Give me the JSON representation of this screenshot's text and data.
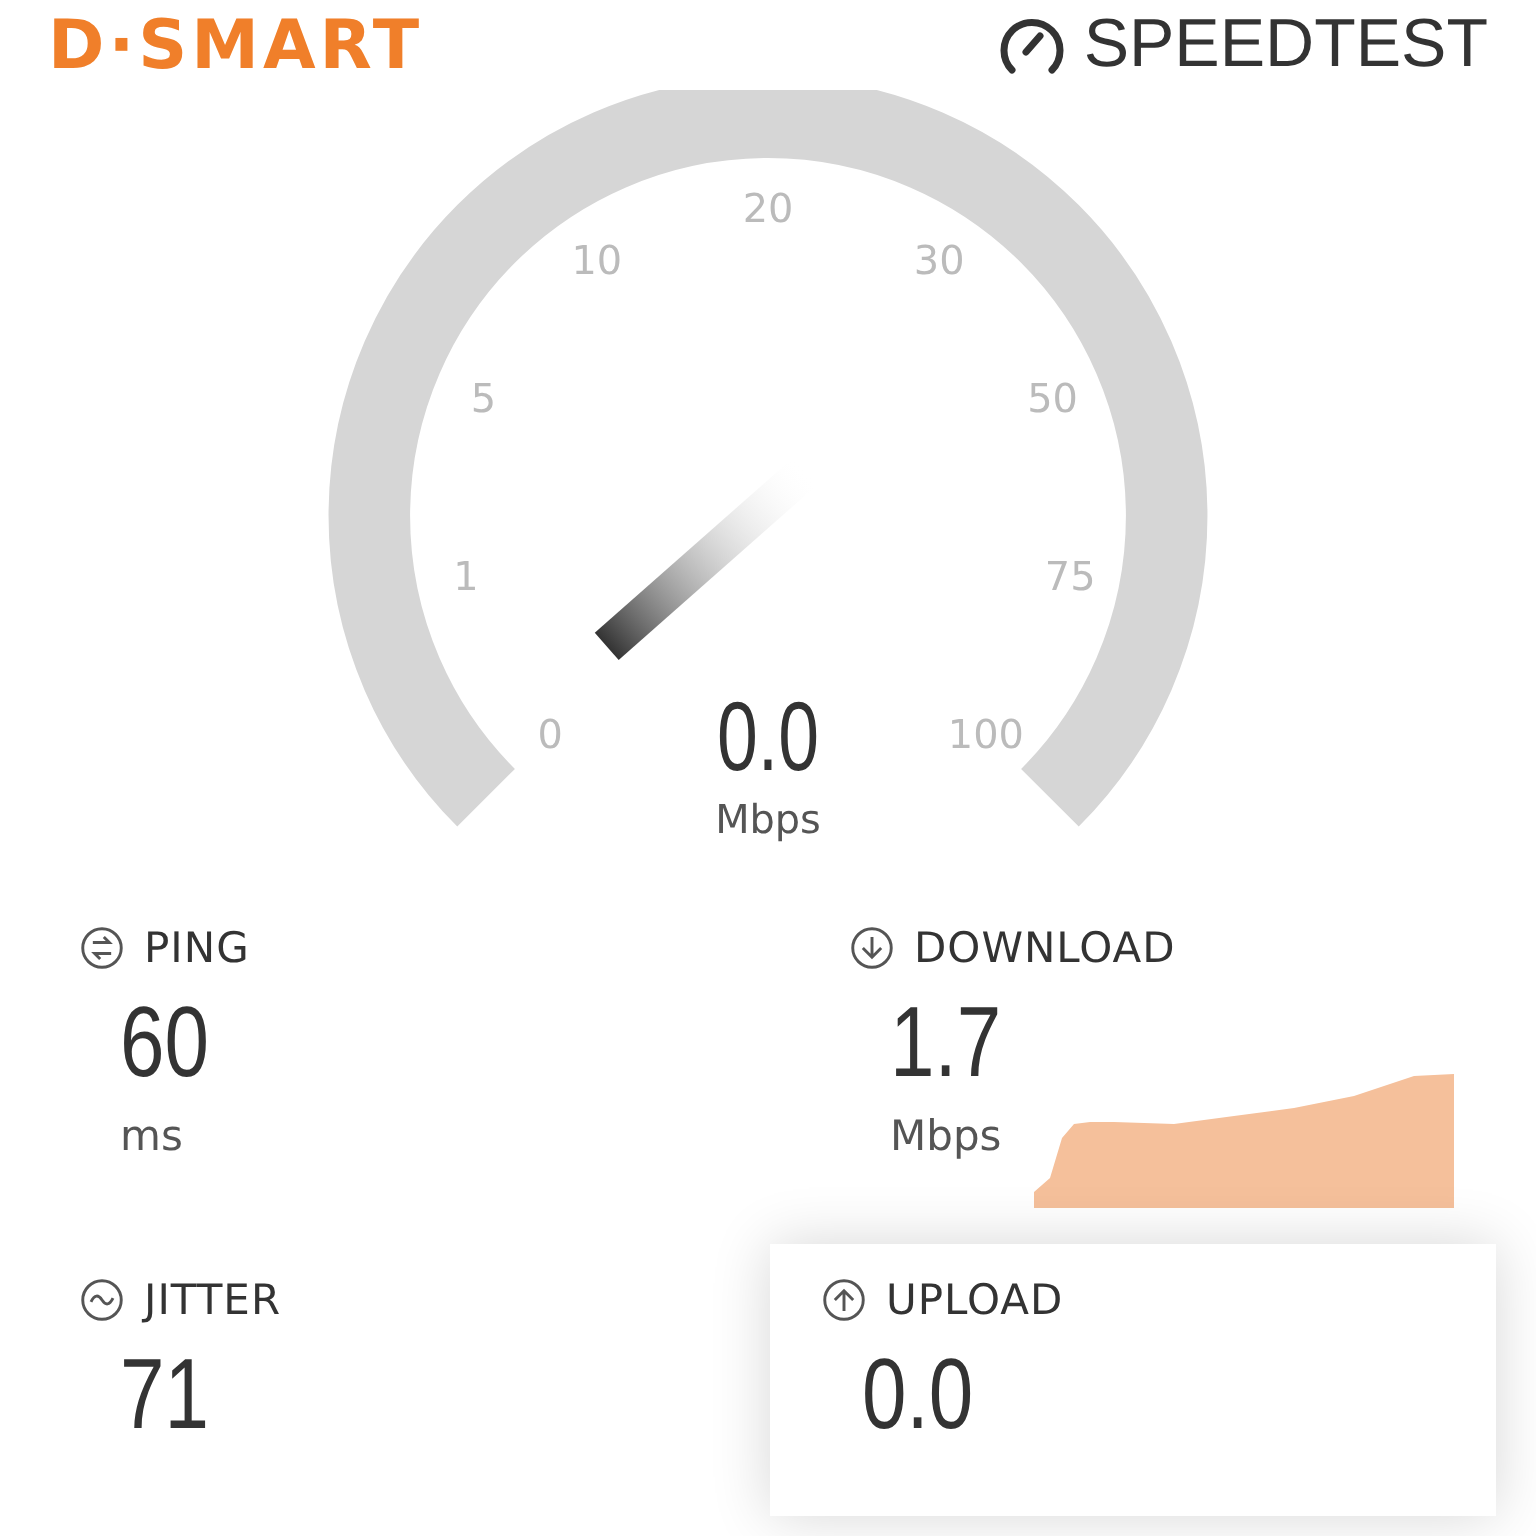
{
  "header": {
    "brand": "D·SMART",
    "speedtest_logo": "SPEEDTEST"
  },
  "gauge": {
    "ticks": [
      "0",
      "1",
      "5",
      "10",
      "20",
      "30",
      "50",
      "75",
      "100"
    ],
    "reading": "0.0",
    "unit": "Mbps"
  },
  "metrics": [
    {
      "kind": "ping",
      "label": "PING",
      "value": "60",
      "unit": "ms",
      "selected": false
    },
    {
      "kind": "download",
      "label": "DOWNLOAD",
      "value": "1.7",
      "unit": "Mbps",
      "selected": false
    },
    {
      "kind": "jitter",
      "label": "JITTER",
      "value": "71",
      "selected": false
    },
    {
      "kind": "upload",
      "label": "UPLOAD",
      "value": "0.0",
      "selected": true
    }
  ]
}
